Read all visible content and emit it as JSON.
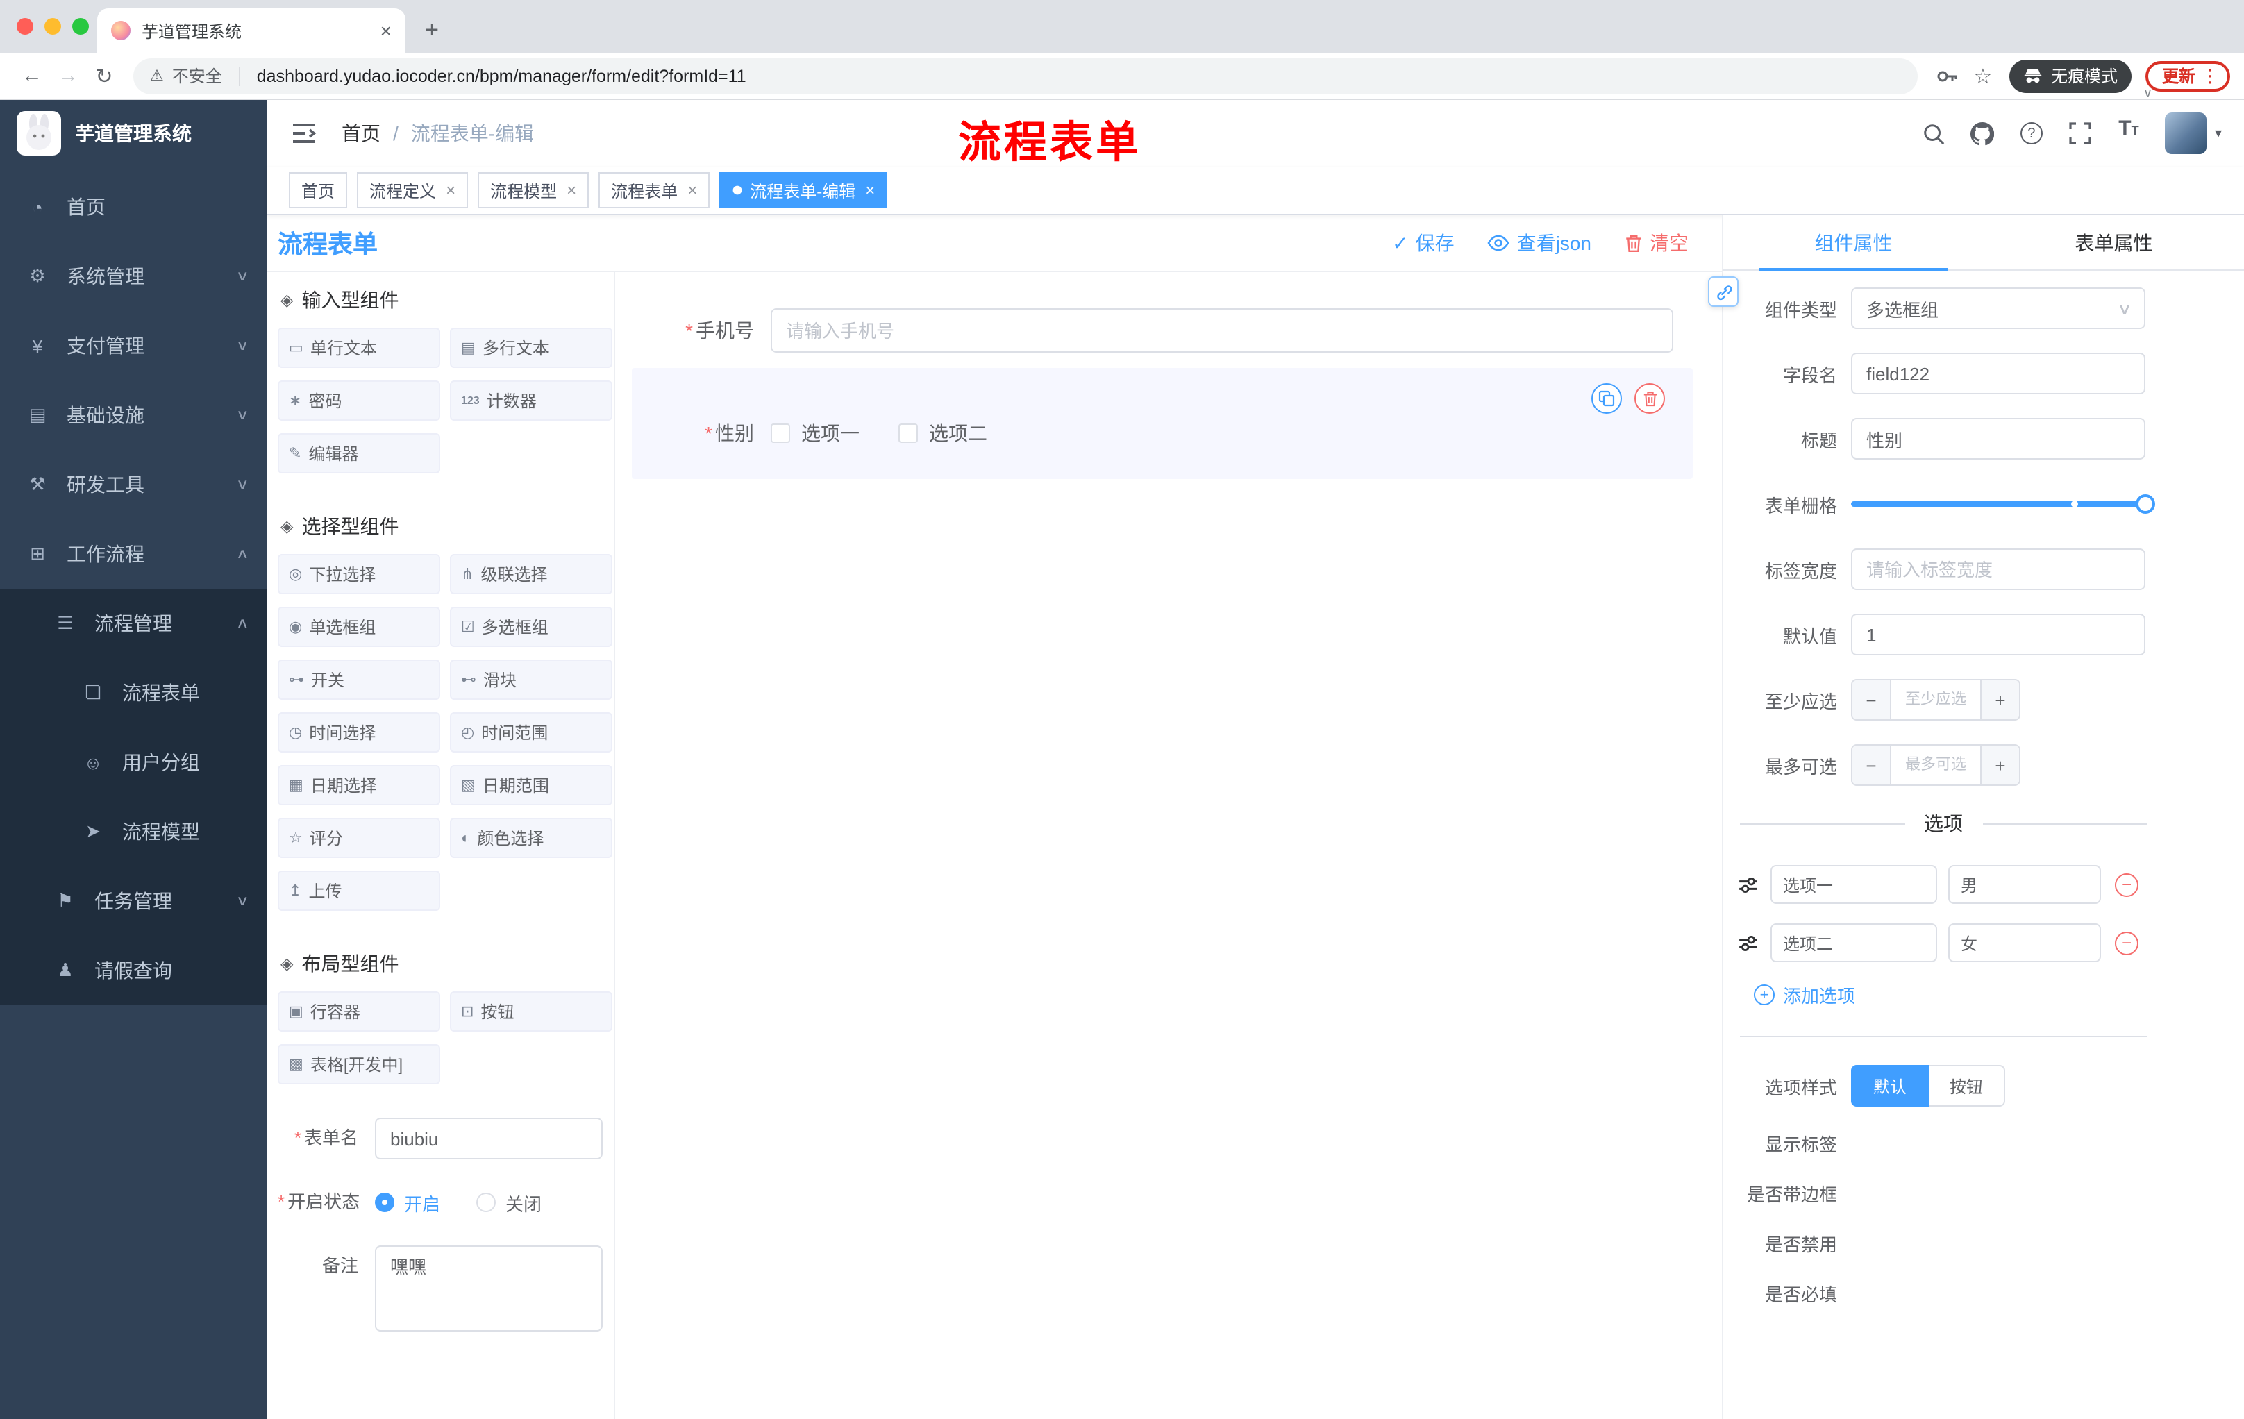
{
  "browser": {
    "tab_title": "芋道管理系统",
    "security_label": "不安全",
    "url": "dashboard.yudao.iocoder.cn/bpm/manager/form/edit?formId=11",
    "incognito_label": "无痕模式",
    "update_label": "更新"
  },
  "icons": {
    "close": "×",
    "new_tab": "+",
    "back": "←",
    "forward": "→",
    "reload": "↻",
    "warning": "⚠",
    "star": "☆",
    "kebab": "⋮",
    "chevron_small": "∨",
    "slash": "/",
    "question": "?",
    "font_size": "T",
    "caret": "▾",
    "asterisk": "*",
    "check": "✓",
    "dot": "●",
    "plus": "+",
    "minus": "−",
    "select_caret": "∨"
  },
  "sidebar": {
    "logo_title": "芋道管理系统",
    "items": [
      {
        "label": "首页",
        "icon": "◔"
      },
      {
        "label": "系统管理",
        "icon": "⚙",
        "chevron": "∨"
      },
      {
        "label": "支付管理",
        "icon": "¥",
        "chevron": "∨"
      },
      {
        "label": "基础设施",
        "icon": "▤",
        "chevron": "∨"
      },
      {
        "label": "研发工具",
        "icon": "⚒",
        "chevron": "∨"
      },
      {
        "label": "工作流程",
        "icon": "⊞",
        "chevron": "∧"
      },
      {
        "label": "流程管理",
        "icon": "☰",
        "chevron": "∧"
      },
      {
        "label": "流程表单",
        "icon": "❏"
      },
      {
        "label": "用户分组",
        "icon": "☺"
      },
      {
        "label": "流程模型",
        "icon": "➤"
      },
      {
        "label": "任务管理",
        "icon": "⚑",
        "chevron": "∨"
      },
      {
        "label": "请假查询",
        "icon": "♟"
      }
    ]
  },
  "header": {
    "breadcrumb_home": "首页",
    "breadcrumb_current": "流程表单-编辑",
    "annotation": "流程表单"
  },
  "tags": [
    {
      "label": "首页"
    },
    {
      "label": "流程定义"
    },
    {
      "label": "流程模型"
    },
    {
      "label": "流程表单"
    },
    {
      "label": "流程表单-编辑"
    }
  ],
  "editor": {
    "title": "流程表单",
    "save": "保存",
    "view_json": "查看json",
    "clear": "清空"
  },
  "palette": {
    "groups": [
      {
        "title": "输入型组件",
        "items": [
          {
            "label": "单行文本",
            "icon": "▭"
          },
          {
            "label": "多行文本",
            "icon": "▤"
          },
          {
            "label": "密码",
            "icon": "∗"
          },
          {
            "label": "计数器",
            "icon": "123"
          },
          {
            "label": "编辑器",
            "icon": "✎"
          }
        ]
      },
      {
        "title": "选择型组件",
        "items": [
          {
            "label": "下拉选择",
            "icon": "◎"
          },
          {
            "label": "级联选择",
            "icon": "⋔"
          },
          {
            "label": "单选框组",
            "icon": "◉"
          },
          {
            "label": "多选框组",
            "icon": "☑"
          },
          {
            "label": "开关",
            "icon": "⊶"
          },
          {
            "label": "滑块",
            "icon": "⊷"
          },
          {
            "label": "时间选择",
            "icon": "◷"
          },
          {
            "label": "时间范围",
            "icon": "◴"
          },
          {
            "label": "日期选择",
            "icon": "▦"
          },
          {
            "label": "日期范围",
            "icon": "▧"
          },
          {
            "label": "评分",
            "icon": "☆"
          },
          {
            "label": "颜色选择",
            "icon": "◐"
          },
          {
            "label": "上传",
            "icon": "↥"
          }
        ]
      },
      {
        "title": "布局型组件",
        "items": [
          {
            "label": "行容器",
            "icon": "▣"
          },
          {
            "label": "按钮",
            "icon": "⊡"
          },
          {
            "label": "表格[开发中]",
            "icon": "▩"
          }
        ]
      }
    ],
    "form": {
      "name_label": "表单名",
      "name_value": "biubiu",
      "status_label": "开启状态",
      "status_on": "开启",
      "status_off": "关闭",
      "remark_label": "备注",
      "remark_value": "嘿嘿"
    }
  },
  "canvas": {
    "phone_label": "手机号",
    "phone_placeholder": "请输入手机号",
    "gender_label": "性别",
    "gender_options": [
      {
        "label": "选项一"
      },
      {
        "label": "选项二"
      }
    ]
  },
  "props": {
    "tab_component": "组件属性",
    "tab_form": "表单属性",
    "component_type_label": "组件类型",
    "component_type_value": "多选框组",
    "field_name_label": "字段名",
    "field_name_value": "field122",
    "title_label": "标题",
    "title_value": "性别",
    "grid_label": "表单栅格",
    "label_width_label": "标签宽度",
    "label_width_placeholder": "请输入标签宽度",
    "default_label": "默认值",
    "default_value": "1",
    "min_label": "至少应选",
    "min_placeholder": "至少应选",
    "max_label": "最多可选",
    "max_placeholder": "最多可选",
    "options_title": "选项",
    "options": [
      {
        "label": "选项一",
        "value": "男"
      },
      {
        "label": "选项二",
        "value": "女"
      }
    ],
    "add_option": "添加选项",
    "option_style_label": "选项样式",
    "style_default": "默认",
    "style_button": "按钮",
    "toggle_show_label": "显示标签",
    "toggle_border": "是否带边框",
    "toggle_disabled": "是否禁用",
    "toggle_required": "是否必填"
  },
  "colors": {
    "accent": "#409EFF",
    "danger": "#F56C6C",
    "annotation": "#FF0000",
    "sidebar_bg": "#304156",
    "submenu_bg": "#1F2D3D"
  }
}
